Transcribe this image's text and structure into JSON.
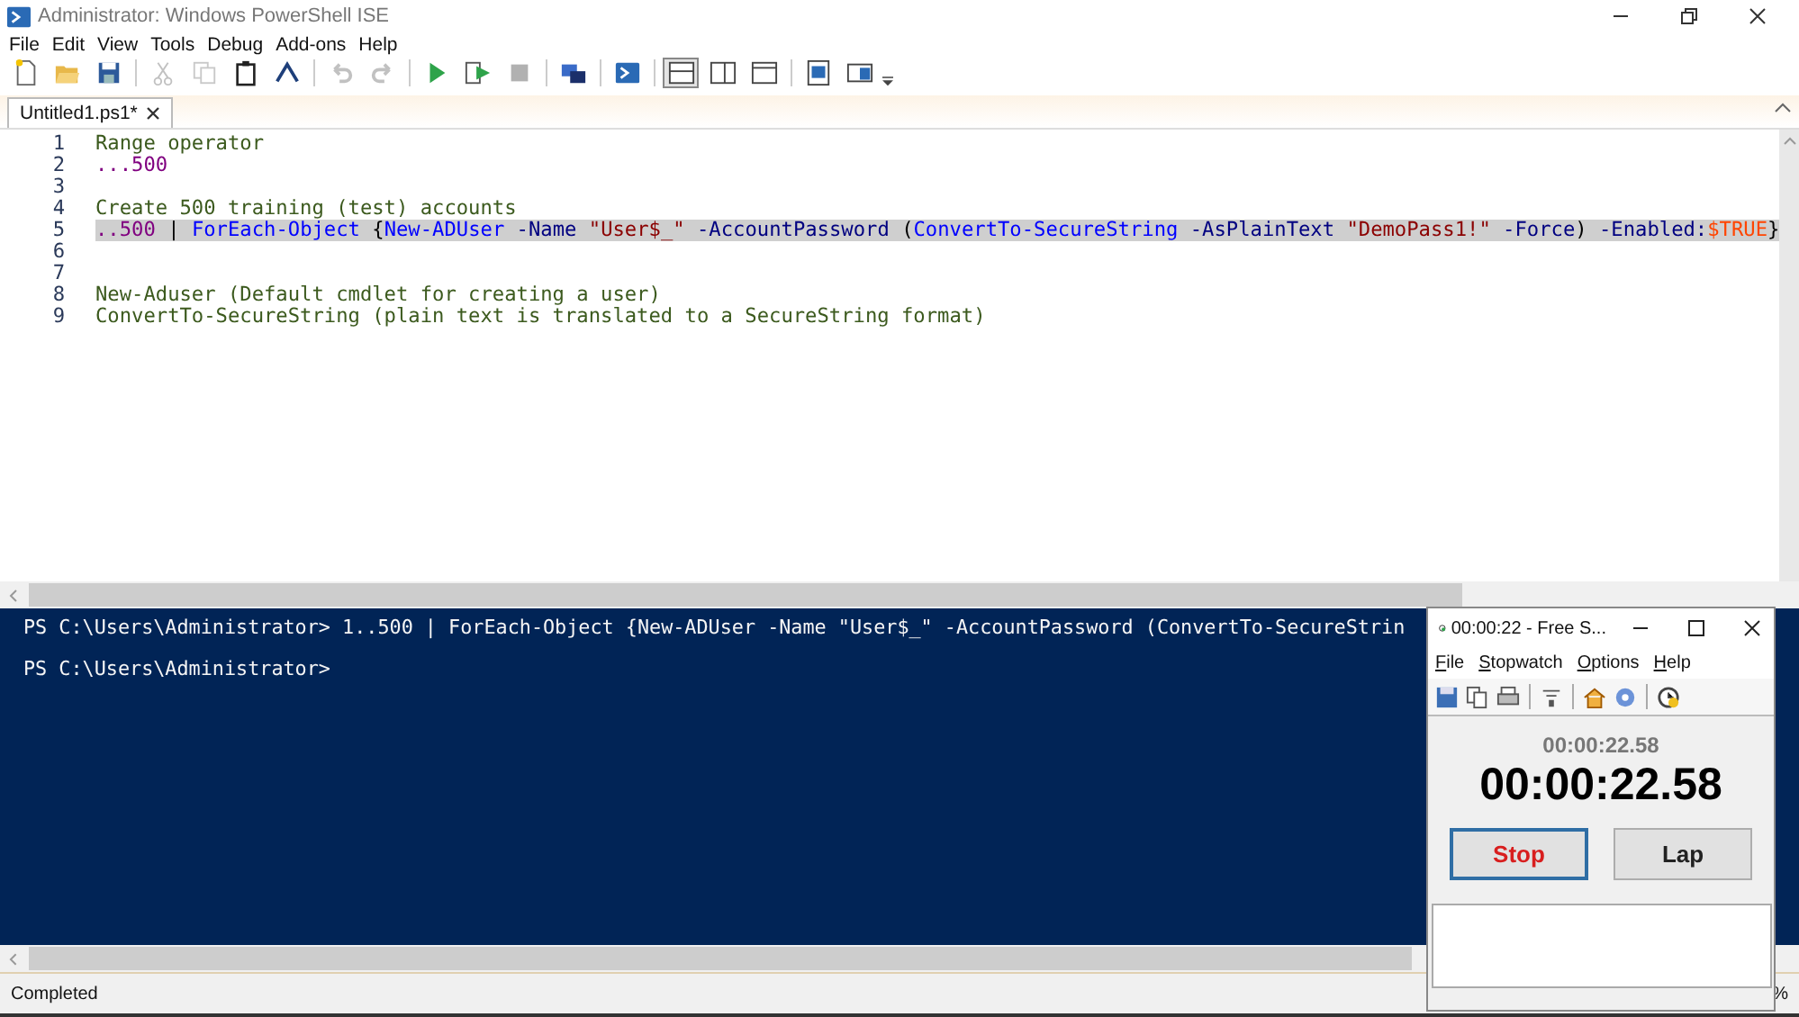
{
  "window": {
    "title": "Administrator: Windows PowerShell ISE"
  },
  "menu": [
    "File",
    "Edit",
    "View",
    "Tools",
    "Debug",
    "Add-ons",
    "Help"
  ],
  "toolbar": [
    {
      "kind": "new",
      "disabled": false
    },
    {
      "kind": "open",
      "disabled": false
    },
    {
      "kind": "save",
      "disabled": false
    },
    {
      "kind": "sep"
    },
    {
      "kind": "cut",
      "disabled": true
    },
    {
      "kind": "copy",
      "disabled": true
    },
    {
      "kind": "paste",
      "disabled": false
    },
    {
      "kind": "clear",
      "disabled": false
    },
    {
      "kind": "sep"
    },
    {
      "kind": "undo",
      "disabled": true
    },
    {
      "kind": "redo",
      "disabled": true
    },
    {
      "kind": "sep"
    },
    {
      "kind": "run",
      "disabled": false
    },
    {
      "kind": "runsel",
      "disabled": false
    },
    {
      "kind": "stop",
      "disabled": true
    },
    {
      "kind": "sep"
    },
    {
      "kind": "remote",
      "disabled": false
    },
    {
      "kind": "sep"
    },
    {
      "kind": "shell",
      "disabled": false
    },
    {
      "kind": "sep"
    },
    {
      "kind": "paneTop",
      "disabled": false,
      "selected": true
    },
    {
      "kind": "paneRight",
      "disabled": false,
      "selected": false
    },
    {
      "kind": "paneMax",
      "disabled": false,
      "selected": false
    },
    {
      "kind": "sep"
    },
    {
      "kind": "cmd",
      "disabled": false
    },
    {
      "kind": "addon",
      "disabled": false
    }
  ],
  "tabs": [
    {
      "label": "Untitled1.ps1*",
      "selected": true
    }
  ],
  "editor": {
    "lines": [
      {
        "number": "1",
        "highlighted": false,
        "tokens": [
          {
            "kind": "comment",
            "text": "Range operator"
          }
        ]
      },
      {
        "number": "2",
        "highlighted": false,
        "tokens": [
          {
            "kind": "number",
            "text": "...500"
          }
        ]
      },
      {
        "number": "3",
        "highlighted": false
      },
      {
        "number": "4",
        "highlighted": false,
        "tokens": [
          {
            "kind": "comment",
            "text": "Create 500 training (test) accounts"
          }
        ]
      },
      {
        "number": "5",
        "highlighted": true,
        "tokens": [
          {
            "kind": "number",
            "text": "..500"
          },
          {
            "kind": "plain",
            "text": " | "
          },
          {
            "kind": "command",
            "text": "ForEach-Object"
          },
          {
            "kind": "plain",
            "text": " {"
          },
          {
            "kind": "command",
            "text": "New-ADUser"
          },
          {
            "kind": "param",
            "text": " -Name "
          },
          {
            "kind": "string",
            "text": "\"User$_\""
          },
          {
            "kind": "param",
            "text": " -AccountPassword "
          },
          {
            "kind": "plain",
            "text": "("
          },
          {
            "kind": "command",
            "text": "ConvertTo-SecureString"
          },
          {
            "kind": "param",
            "text": " -AsPlainText "
          },
          {
            "kind": "string",
            "text": "\"DemoPass1!\""
          },
          {
            "kind": "param",
            "text": " -Force"
          },
          {
            "kind": "plain",
            "text": ") "
          },
          {
            "kind": "param",
            "text": "-Enabled:"
          },
          {
            "kind": "variable",
            "text": "$TRUE"
          },
          {
            "kind": "plain",
            "text": "}"
          }
        ]
      },
      {
        "number": "6",
        "highlighted": false
      },
      {
        "number": "7",
        "highlighted": false
      },
      {
        "number": "8",
        "highlighted": false,
        "tokens": [
          {
            "kind": "comment",
            "text": "New-Aduser (Default cmdlet for creating a user)"
          }
        ]
      },
      {
        "number": "9",
        "highlighted": false,
        "tokens": [
          {
            "kind": "comment",
            "text": "ConvertTo-SecureString (plain text is translated to a SecureString format)"
          }
        ]
      }
    ]
  },
  "console": {
    "lines": [
      "PS C:\\Users\\Administrator> 1..500 | ForEach-Object {New-ADUser -Name \"User$_\" -AccountPassword (ConvertTo-SecureStrin",
      "PS C:\\Users\\Administrator>"
    ]
  },
  "status_bar": {
    "text": "Completed",
    "zoom": "%"
  },
  "stopwatch": {
    "title": "00:00:22 - Free S...",
    "menu": [
      "File",
      "Stopwatch",
      "Options",
      "Help"
    ],
    "toolbar": [
      {
        "kind": "save"
      },
      {
        "kind": "copy"
      },
      {
        "kind": "print"
      },
      {
        "kind": "sep"
      },
      {
        "kind": "filter"
      },
      {
        "kind": "sep"
      },
      {
        "kind": "home"
      },
      {
        "kind": "info"
      },
      {
        "kind": "sep"
      },
      {
        "kind": "clock"
      }
    ],
    "elapsed_small": "00:00:22.58",
    "elapsed": "00:00:22.58",
    "buttons": [
      {
        "label": "Stop",
        "kind": "stop",
        "focused": true
      },
      {
        "label": "Lap",
        "kind": "lap",
        "focused": false
      }
    ]
  }
}
